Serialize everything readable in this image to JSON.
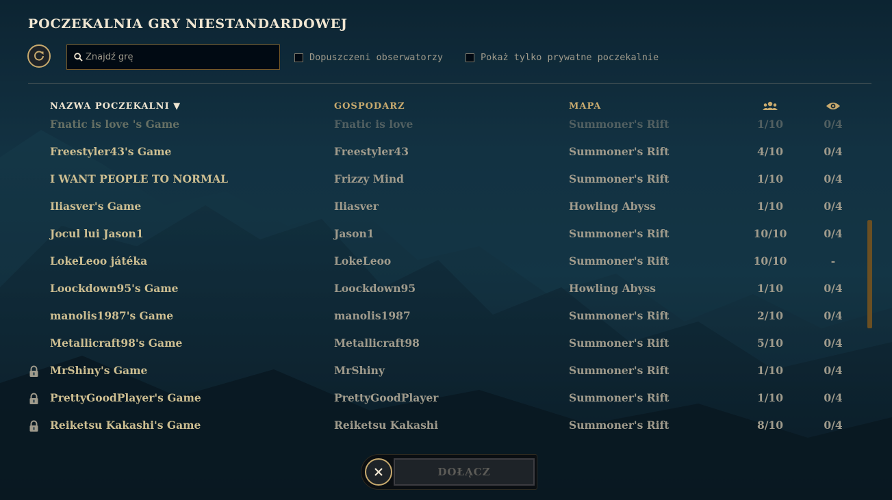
{
  "page_title": "POCZEKALNIA GRY NIESTANDARDOWEJ",
  "search": {
    "placeholder": "Znajdź grę",
    "value": ""
  },
  "filters": {
    "spectators_allowed": {
      "label": "Dopuszczeni obserwatorzy",
      "checked": false
    },
    "private_only": {
      "label": "Pokaż tylko prywatne poczekalnie",
      "checked": false
    }
  },
  "columns": {
    "name": "NAZWA POCZEKALNI ▼",
    "host": "GOSPODARZ",
    "map": "MAPA",
    "players_icon": "players-icon",
    "spectators_icon": "eye-icon"
  },
  "lobbies": [
    {
      "name": "Fnatic is love 's Game",
      "host": "Fnatic is love",
      "map": "Summoner's Rift",
      "players": "1/10",
      "spectators": "0/4",
      "locked": false,
      "faded": true
    },
    {
      "name": "Freestyler43's Game",
      "host": "Freestyler43",
      "map": "Summoner's Rift",
      "players": "4/10",
      "spectators": "0/4",
      "locked": false,
      "faded": false
    },
    {
      "name": "I WANT PEOPLE TO NORMAL",
      "host": "Frizzy Mind",
      "map": "Summoner's Rift",
      "players": "1/10",
      "spectators": "0/4",
      "locked": false,
      "faded": false
    },
    {
      "name": "Iliasver's Game",
      "host": "Iliasver",
      "map": "Howling Abyss",
      "players": "1/10",
      "spectators": "0/4",
      "locked": false,
      "faded": false
    },
    {
      "name": "Jocul lui Jason1",
      "host": "Jason1",
      "map": "Summoner's Rift",
      "players": "10/10",
      "spectators": "0/4",
      "locked": false,
      "faded": false
    },
    {
      "name": "LokeLeoo játéka",
      "host": "LokeLeoo",
      "map": "Summoner's Rift",
      "players": "10/10",
      "spectators": "-",
      "locked": false,
      "faded": false
    },
    {
      "name": "Loockdown95's Game",
      "host": "Loockdown95",
      "map": "Howling Abyss",
      "players": "1/10",
      "spectators": "0/4",
      "locked": false,
      "faded": false
    },
    {
      "name": "manolis1987's Game",
      "host": "manolis1987",
      "map": "Summoner's Rift",
      "players": "2/10",
      "spectators": "0/4",
      "locked": false,
      "faded": false
    },
    {
      "name": "Metallicraft98's Game",
      "host": "Metallicraft98",
      "map": "Summoner's Rift",
      "players": "5/10",
      "spectators": "0/4",
      "locked": false,
      "faded": false
    },
    {
      "name": "MrShiny's Game",
      "host": "MrShiny",
      "map": "Summoner's Rift",
      "players": "1/10",
      "spectators": "0/4",
      "locked": true,
      "faded": false
    },
    {
      "name": "PrettyGoodPlayer's Game",
      "host": "PrettyGoodPlayer",
      "map": "Summoner's Rift",
      "players": "1/10",
      "spectators": "0/4",
      "locked": true,
      "faded": false
    },
    {
      "name": "Reiketsu Kakashi's Game",
      "host": "Reiketsu Kakashi",
      "map": "Summoner's Rift",
      "players": "8/10",
      "spectators": "0/4",
      "locked": true,
      "faded": false
    }
  ],
  "footer": {
    "join_label": "DOŁĄCZ",
    "close_icon": "close-icon"
  },
  "colors": {
    "gold": "#c8aa6e",
    "text": "#cdbe91",
    "muted": "#a09b8c"
  }
}
